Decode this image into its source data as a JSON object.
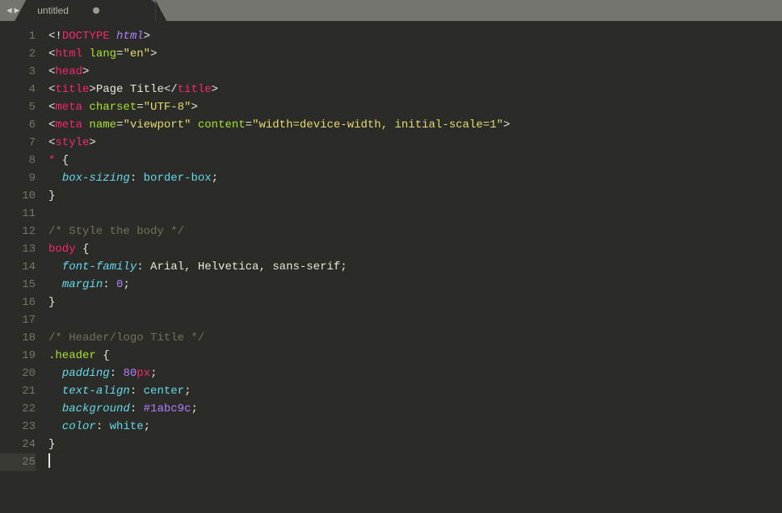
{
  "tab": {
    "title": "untitled",
    "dirty": true
  },
  "active_line": 25,
  "lines": [
    {
      "n": 1,
      "tokens": [
        {
          "t": "<!",
          "c": "p-punct"
        },
        {
          "t": "DOCTYPE",
          "c": "p-doctype"
        },
        {
          "t": " ",
          "c": "p-white"
        },
        {
          "t": "html",
          "c": "p-html"
        },
        {
          "t": ">",
          "c": "p-punct"
        }
      ]
    },
    {
      "n": 2,
      "tokens": [
        {
          "t": "<",
          "c": "p-punct"
        },
        {
          "t": "html",
          "c": "p-tag"
        },
        {
          "t": " ",
          "c": "p-white"
        },
        {
          "t": "lang",
          "c": "p-attr"
        },
        {
          "t": "=",
          "c": "p-punct"
        },
        {
          "t": "\"en\"",
          "c": "p-string"
        },
        {
          "t": ">",
          "c": "p-punct"
        }
      ]
    },
    {
      "n": 3,
      "tokens": [
        {
          "t": "<",
          "c": "p-punct"
        },
        {
          "t": "head",
          "c": "p-tag"
        },
        {
          "t": ">",
          "c": "p-punct"
        }
      ]
    },
    {
      "n": 4,
      "tokens": [
        {
          "t": "<",
          "c": "p-punct"
        },
        {
          "t": "title",
          "c": "p-tag"
        },
        {
          "t": ">",
          "c": "p-punct"
        },
        {
          "t": "Page Title",
          "c": "p-white"
        },
        {
          "t": "</",
          "c": "p-punct"
        },
        {
          "t": "title",
          "c": "p-tag"
        },
        {
          "t": ">",
          "c": "p-punct"
        }
      ]
    },
    {
      "n": 5,
      "tokens": [
        {
          "t": "<",
          "c": "p-punct"
        },
        {
          "t": "meta",
          "c": "p-tag"
        },
        {
          "t": " ",
          "c": "p-white"
        },
        {
          "t": "charset",
          "c": "p-attr"
        },
        {
          "t": "=",
          "c": "p-punct"
        },
        {
          "t": "\"UTF-8\"",
          "c": "p-string"
        },
        {
          "t": ">",
          "c": "p-punct"
        }
      ]
    },
    {
      "n": 6,
      "tokens": [
        {
          "t": "<",
          "c": "p-punct"
        },
        {
          "t": "meta",
          "c": "p-tag"
        },
        {
          "t": " ",
          "c": "p-white"
        },
        {
          "t": "name",
          "c": "p-attr"
        },
        {
          "t": "=",
          "c": "p-punct"
        },
        {
          "t": "\"viewport\"",
          "c": "p-string"
        },
        {
          "t": " ",
          "c": "p-white"
        },
        {
          "t": "content",
          "c": "p-attr"
        },
        {
          "t": "=",
          "c": "p-punct"
        },
        {
          "t": "\"width=device-width, initial-scale=1\"",
          "c": "p-string"
        },
        {
          "t": ">",
          "c": "p-punct"
        }
      ]
    },
    {
      "n": 7,
      "tokens": [
        {
          "t": "<",
          "c": "p-punct"
        },
        {
          "t": "style",
          "c": "p-tag"
        },
        {
          "t": ">",
          "c": "p-punct"
        }
      ]
    },
    {
      "n": 8,
      "tokens": [
        {
          "t": "*",
          "c": "p-star"
        },
        {
          "t": " {",
          "c": "p-white"
        }
      ]
    },
    {
      "n": 9,
      "tokens": [
        {
          "t": "  ",
          "c": "p-white"
        },
        {
          "t": "box-sizing",
          "c": "p-prop"
        },
        {
          "t": ": ",
          "c": "p-white"
        },
        {
          "t": "border-box",
          "c": "p-val"
        },
        {
          "t": ";",
          "c": "p-white"
        }
      ]
    },
    {
      "n": 10,
      "tokens": [
        {
          "t": "}",
          "c": "p-white"
        }
      ]
    },
    {
      "n": 11,
      "tokens": []
    },
    {
      "n": 12,
      "tokens": [
        {
          "t": "/* Style the body */",
          "c": "p-comment"
        }
      ]
    },
    {
      "n": 13,
      "tokens": [
        {
          "t": "body",
          "c": "p-tag"
        },
        {
          "t": " {",
          "c": "p-white"
        }
      ]
    },
    {
      "n": 14,
      "tokens": [
        {
          "t": "  ",
          "c": "p-white"
        },
        {
          "t": "font-family",
          "c": "p-prop"
        },
        {
          "t": ": Arial, Helvetica, sans-serif;",
          "c": "p-white"
        }
      ]
    },
    {
      "n": 15,
      "tokens": [
        {
          "t": "  ",
          "c": "p-white"
        },
        {
          "t": "margin",
          "c": "p-prop"
        },
        {
          "t": ": ",
          "c": "p-white"
        },
        {
          "t": "0",
          "c": "p-num"
        },
        {
          "t": ";",
          "c": "p-white"
        }
      ]
    },
    {
      "n": 16,
      "tokens": [
        {
          "t": "}",
          "c": "p-white"
        }
      ]
    },
    {
      "n": 17,
      "tokens": []
    },
    {
      "n": 18,
      "tokens": [
        {
          "t": "/* Header/logo Title */",
          "c": "p-comment"
        }
      ]
    },
    {
      "n": 19,
      "tokens": [
        {
          "t": ".header",
          "c": "p-selector"
        },
        {
          "t": " {",
          "c": "p-white"
        }
      ]
    },
    {
      "n": 20,
      "tokens": [
        {
          "t": "  ",
          "c": "p-white"
        },
        {
          "t": "padding",
          "c": "p-prop"
        },
        {
          "t": ": ",
          "c": "p-white"
        },
        {
          "t": "80",
          "c": "p-num"
        },
        {
          "t": "px",
          "c": "p-tag"
        },
        {
          "t": ";",
          "c": "p-white"
        }
      ]
    },
    {
      "n": 21,
      "tokens": [
        {
          "t": "  ",
          "c": "p-white"
        },
        {
          "t": "text-align",
          "c": "p-prop"
        },
        {
          "t": ": ",
          "c": "p-white"
        },
        {
          "t": "center",
          "c": "p-val"
        },
        {
          "t": ";",
          "c": "p-white"
        }
      ]
    },
    {
      "n": 22,
      "tokens": [
        {
          "t": "  ",
          "c": "p-white"
        },
        {
          "t": "background",
          "c": "p-prop"
        },
        {
          "t": ": ",
          "c": "p-white"
        },
        {
          "t": "#1abc9c",
          "c": "p-num"
        },
        {
          "t": ";",
          "c": "p-white"
        }
      ]
    },
    {
      "n": 23,
      "tokens": [
        {
          "t": "  ",
          "c": "p-white"
        },
        {
          "t": "color",
          "c": "p-prop"
        },
        {
          "t": ": ",
          "c": "p-white"
        },
        {
          "t": "white",
          "c": "p-val"
        },
        {
          "t": ";",
          "c": "p-white"
        }
      ]
    },
    {
      "n": 24,
      "tokens": [
        {
          "t": "}",
          "c": "p-white"
        }
      ]
    },
    {
      "n": 25,
      "tokens": []
    }
  ]
}
